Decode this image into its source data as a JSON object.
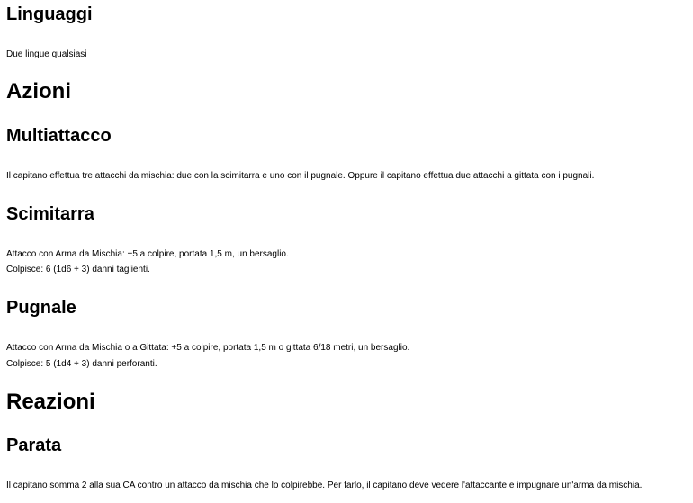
{
  "sections": {
    "languages": {
      "heading": "Linguaggi",
      "text": "Due lingue qualsiasi"
    },
    "actions": {
      "heading": "Azioni",
      "multiattack": {
        "heading": "Multiattacco",
        "text": "Il capitano effettua tre attacchi da mischia: due con la scimitarra e uno con il pugnale. Oppure il capitano effettua due attacchi a gittata con i pugnali."
      },
      "scimitar": {
        "heading": "Scimitarra",
        "line1": "Attacco con Arma da Mischia: +5 a colpire, portata 1,5 m, un bersaglio.",
        "line2": "Colpisce: 6 (1d6 + 3) danni taglienti."
      },
      "dagger": {
        "heading": "Pugnale",
        "line1": "Attacco con Arma da Mischia o a Gittata: +5 a colpire, portata 1,5 m o gittata 6/18 metri, un bersaglio.",
        "line2": "Colpisce: 5 (1d4 + 3) danni perforanti."
      }
    },
    "reactions": {
      "heading": "Reazioni",
      "parry": {
        "heading": "Parata",
        "text": "Il capitano somma 2 alla sua CA contro un attacco da mischia che lo colpirebbe. Per farlo, il capitano deve vedere l'attaccante e impugnare un'arma da mischia."
      }
    }
  }
}
